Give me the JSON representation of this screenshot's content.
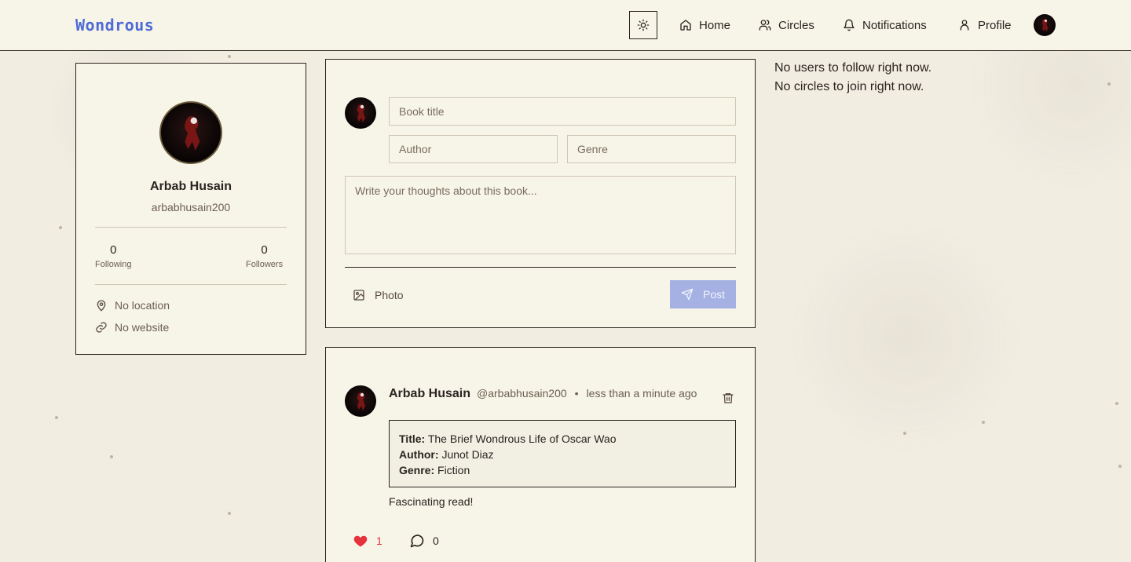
{
  "header": {
    "logo": "Wondrous",
    "nav": [
      {
        "label": "Home",
        "icon": "home-icon"
      },
      {
        "label": "Circles",
        "icon": "users-icon"
      },
      {
        "label": "Notifications",
        "icon": "bell-icon"
      },
      {
        "label": "Profile",
        "icon": "user-icon"
      }
    ],
    "theme_icon": "sun-icon"
  },
  "profile": {
    "name": "Arbab Husain",
    "handle": "arbabhusain200",
    "following_count": "0",
    "following_label": "Following",
    "followers_count": "0",
    "followers_label": "Followers",
    "location": "No location",
    "website": "No website"
  },
  "composer": {
    "title_placeholder": "Book title",
    "author_placeholder": "Author",
    "genre_placeholder": "Genre",
    "thoughts_placeholder": "Write your thoughts about this book...",
    "photo_label": "Photo",
    "post_label": "Post"
  },
  "post": {
    "author": "Arbab Husain",
    "handle": "@arbabhusain200",
    "separator": "•",
    "time": "less than a minute ago",
    "title_label": "Title:",
    "title": "The Brief Wondrous Life of Oscar Wao",
    "author_label": "Author:",
    "book_author": "Junot Diaz",
    "genre_label": "Genre:",
    "genre": "Fiction",
    "body": "Fascinating read!",
    "likes": "1",
    "comments": "0"
  },
  "sidebar_right": {
    "no_users": "No users to follow right now.",
    "no_circles": "No circles to join right now."
  },
  "colors": {
    "accent": "#4e6bd6",
    "post_button": "#a5b0e3",
    "like": "#e5333d",
    "background": "#f1ede1",
    "card": "#f7f4e8"
  }
}
